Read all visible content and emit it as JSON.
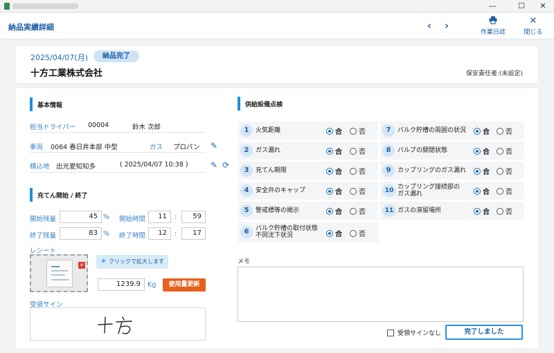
{
  "window": {
    "controls": {
      "minimize": "—",
      "maximize": "☐",
      "close": "✕"
    }
  },
  "header": {
    "title": "納品実績詳細",
    "prev": "‹",
    "next": "›",
    "work_log_label": "作業日誌",
    "close_label": "閉じる"
  },
  "summary": {
    "date": "2025/04/07(月)",
    "status": "納品完了",
    "company": "十方工業株式会社",
    "person_in_charge": "保安責任者:(未設定)"
  },
  "basic": {
    "heading": "基本情報",
    "driver_label": "担当ドライバー",
    "driver_code": "00004",
    "driver_name": "鈴木 次郎",
    "vehicle_label": "車両",
    "vehicle_value": "0064 春日井本部 中型",
    "gas_label": "ガス",
    "gas_value": "プロパン",
    "load_label": "積込地",
    "load_place": "出光愛知知多",
    "load_time": "( 2025/04/07 10:38 )"
  },
  "filling": {
    "heading": "充てん開始 / 終了",
    "start_remain_label": "開始残量",
    "start_remain": "45",
    "end_remain_label": "終了残量",
    "end_remain": "83",
    "percent": "%",
    "start_time_label": "開始時間",
    "start_hour": "11",
    "start_min": "59",
    "end_time_label": "終了時間",
    "end_hour": "12",
    "end_min": "17",
    "colon": ":",
    "receipt_label": "レシート",
    "zoom_hint": "クリックで拡大します",
    "amount": "1239.9",
    "unit": "Kg",
    "update_button": "使用量更新",
    "sign_label": "受領サイン"
  },
  "inspection": {
    "heading": "供給設備点検",
    "ok": "合",
    "ng": "否",
    "items": [
      {
        "no": "1",
        "label": "火気距離"
      },
      {
        "no": "2",
        "label": "ガス漏れ"
      },
      {
        "no": "3",
        "label": "充てん期限"
      },
      {
        "no": "4",
        "label": "安全弁のキャップ"
      },
      {
        "no": "5",
        "label": "警戒標等の掲示"
      },
      {
        "no": "6",
        "label": "バルク貯槽の取付状態\n不同沈下状況"
      },
      {
        "no": "7",
        "label": "バルク貯槽の周囲の状況"
      },
      {
        "no": "8",
        "label": "バルブの開閉状態"
      },
      {
        "no": "9",
        "label": "カップリングのガス漏れ"
      },
      {
        "no": "10",
        "label": "カップリング接続部の\nガス漏れ"
      },
      {
        "no": "11",
        "label": "ガスの滞留場所"
      }
    ]
  },
  "memo": {
    "label": "メモ",
    "value": ""
  },
  "footer": {
    "no_sign_label": "受領サインなし",
    "done_button": "完了しました"
  }
}
